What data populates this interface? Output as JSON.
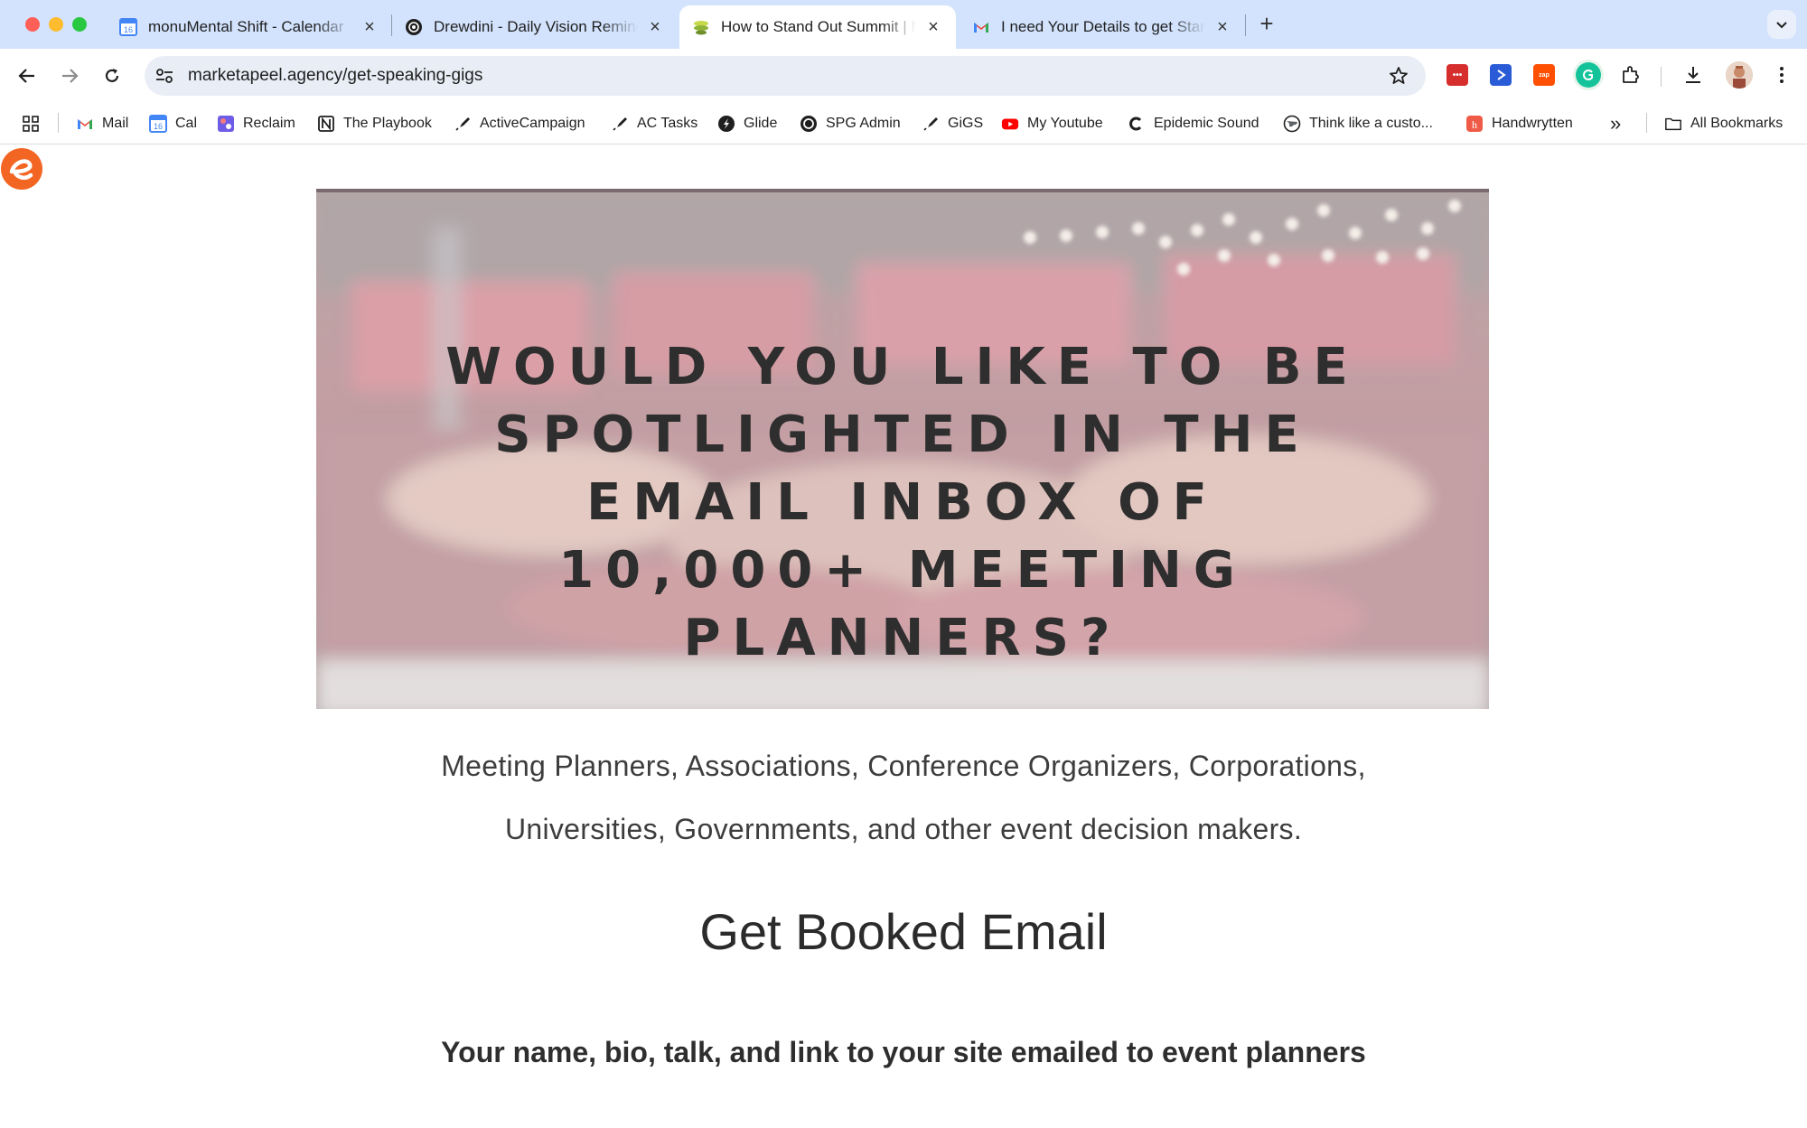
{
  "browser": {
    "tabs": [
      {
        "title": "monuMental Shift - Calendar",
        "icon": "google-calendar-icon",
        "active": false
      },
      {
        "title": "Drewdini - Daily Vision Reminder",
        "icon": "openai-icon",
        "active": false
      },
      {
        "title": "How to Stand Out Summit | MarketaPeel",
        "icon": "summit-icon",
        "active": true
      },
      {
        "title": "I need Your Details to get Started",
        "icon": "gmail-icon",
        "active": false
      }
    ],
    "close_glyph": "×",
    "new_tab_glyph": "+",
    "url": "marketapeel.agency/get-speaking-gigs",
    "bookmarks": [
      {
        "label": "Mail",
        "icon": "gmail-icon"
      },
      {
        "label": "Cal",
        "icon": "google-calendar-icon"
      },
      {
        "label": "Reclaim",
        "icon": "reclaim-icon"
      },
      {
        "label": "The Playbook",
        "icon": "notion-icon"
      },
      {
        "label": "ActiveCampaign",
        "icon": "rocket-icon"
      },
      {
        "label": "AC Tasks",
        "icon": "rocket-icon"
      },
      {
        "label": "Glide",
        "icon": "glide-icon"
      },
      {
        "label": "SPG Admin",
        "icon": "circle-icon"
      },
      {
        "label": "GiGS",
        "icon": "rocket-icon"
      },
      {
        "label": "My Youtube",
        "icon": "youtube-icon"
      },
      {
        "label": "Epidemic Sound",
        "icon": "epidemic-sound-icon"
      },
      {
        "label": "Think like a custo...",
        "icon": "globe-icon"
      },
      {
        "label": "Handwrytten",
        "icon": "handwrytten-icon"
      }
    ],
    "overflow_glyph": "»",
    "all_bookmarks_label": "All Bookmarks",
    "colors": {
      "tabstrip": "#d3e3fd",
      "omnibox": "#e9eef6",
      "accent": "#0b57d0"
    }
  },
  "page": {
    "hero_title": "Would you like to be spotlighted in the email inbox of 10,000+ meeting planners?",
    "subtitle_lines": [
      "Meeting Planners, Associations, Conference Organizers, Corporations,",
      "Universities, Governments, and other event decision makers."
    ],
    "heading": "Get Booked Email",
    "subheading": "Your name, bio, talk, and link to your site emailed to event planners",
    "colors": {
      "heading": "#2b2b2b",
      "text": "#3d3d3d",
      "logo": "#f26522"
    }
  }
}
